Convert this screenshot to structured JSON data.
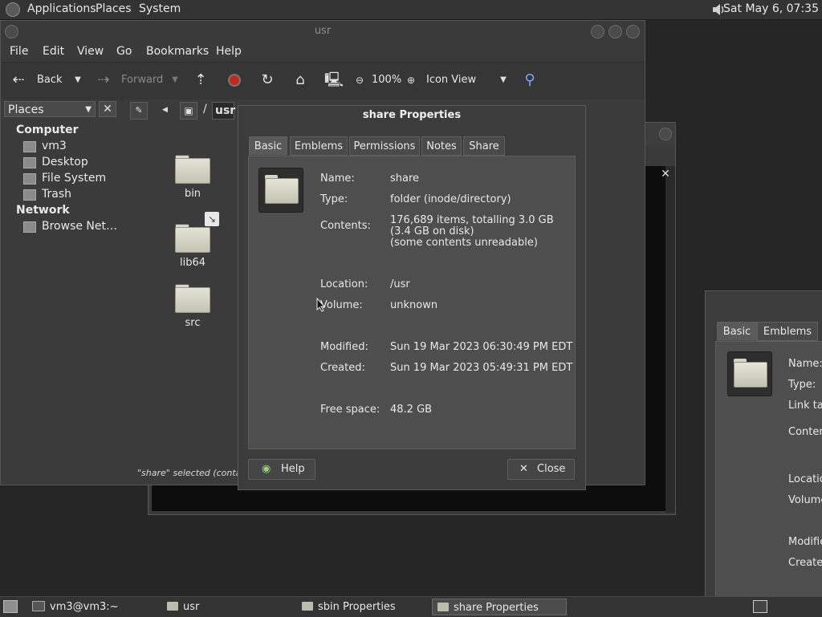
{
  "top_panel": {
    "menus": [
      "Applications",
      "Places",
      "System"
    ],
    "clock": "Sat May  6, 07:35"
  },
  "file_manager": {
    "title": "usr",
    "menubar": [
      "File",
      "Edit",
      "View",
      "Go",
      "Bookmarks",
      "Help"
    ],
    "toolbar": {
      "back": "Back",
      "forward": "Forward",
      "zoom": "100%",
      "view_mode": "Icon View"
    },
    "sidebar": {
      "selector": "Places",
      "computer_heading": "Computer",
      "items_computer": [
        "vm3",
        "Desktop",
        "File System",
        "Trash"
      ],
      "network_heading": "Network",
      "items_network": [
        "Browse Net…"
      ]
    },
    "path": {
      "root": "/",
      "current": "usr"
    },
    "folders": [
      "bin",
      "lib64",
      "src"
    ],
    "status": "\"share\" selected (containi"
  },
  "properties_dialog": {
    "title": "share Properties",
    "tabs": [
      "Basic",
      "Emblems",
      "Permissions",
      "Notes",
      "Share"
    ],
    "fields": {
      "name_label": "Name:",
      "name": "share",
      "type_label": "Type:",
      "type": "folder (inode/directory)",
      "contents_label": "Contents:",
      "contents": "176,689 items, totalling 3.0 GB\n(3.4 GB on disk)\n(some contents unreadable)",
      "location_label": "Location:",
      "location": "/usr",
      "volume_label": "Volume:",
      "volume": "unknown",
      "modified_label": "Modified:",
      "modified": "Sun 19 Mar 2023 06:30:49 PM EDT",
      "created_label": "Created:",
      "created": "Sun 19 Mar 2023 05:49:31 PM EDT",
      "free_label": "Free space:",
      "free": "48.2 GB"
    },
    "help_button": "Help",
    "close_button": "Close"
  },
  "second_dialog": {
    "tabs": [
      "Basic",
      "Emblems"
    ],
    "labels": [
      "Name:",
      "Type:",
      "Link tar",
      "Conten",
      "Locatio",
      "Volume",
      "Modifie",
      "Created"
    ]
  },
  "taskbar": {
    "tasks": [
      "vm3@vm3:~",
      "usr",
      "sbin Properties",
      "share Properties"
    ]
  }
}
